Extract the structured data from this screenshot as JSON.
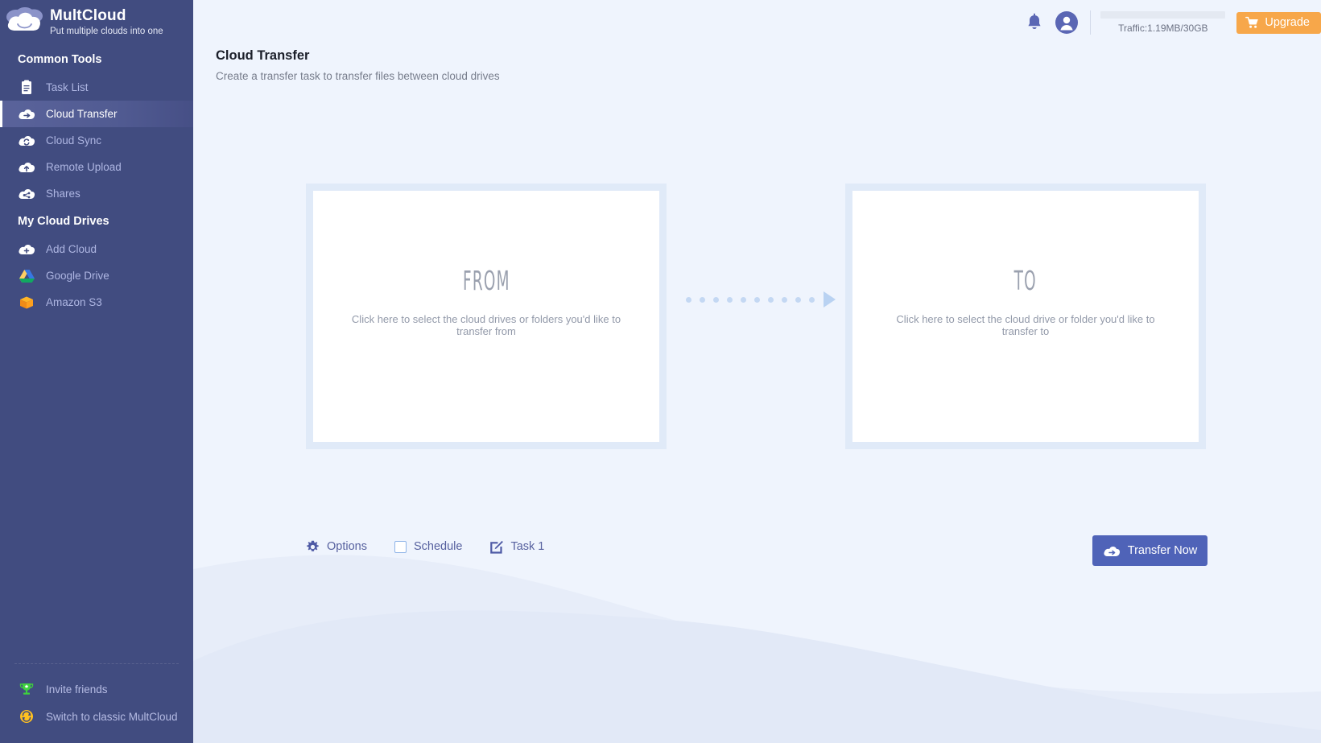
{
  "brand": {
    "name": "MultCloud",
    "tagline": "Put multiple clouds into one",
    "logo_icon": "cloud-logo-icon"
  },
  "sidebar": {
    "sections": [
      {
        "title": "Common Tools",
        "items": [
          {
            "label": "Task List",
            "icon": "task-list-icon",
            "active": false
          },
          {
            "label": "Cloud Transfer",
            "icon": "cloud-transfer-icon",
            "active": true
          },
          {
            "label": "Cloud Sync",
            "icon": "cloud-sync-icon",
            "active": false
          },
          {
            "label": "Remote Upload",
            "icon": "cloud-upload-icon",
            "active": false
          },
          {
            "label": "Shares",
            "icon": "cloud-share-icon",
            "active": false
          }
        ]
      },
      {
        "title": "My Cloud Drives",
        "items": [
          {
            "label": "Add Cloud",
            "icon": "add-cloud-icon",
            "active": false
          },
          {
            "label": "Google Drive",
            "icon": "google-drive-icon",
            "active": false
          },
          {
            "label": "Amazon S3",
            "icon": "amazon-s3-icon",
            "active": false
          }
        ]
      }
    ],
    "bottom_items": [
      {
        "label": "Invite friends",
        "icon": "trophy-icon"
      },
      {
        "label": "Switch to classic MultCloud",
        "icon": "switch-icon"
      }
    ]
  },
  "topbar": {
    "notification_icon": "bell-icon",
    "account_icon": "user-avatar-icon",
    "traffic_text": "Traffic:1.19MB/30GB",
    "traffic_used_percent": 0,
    "upgrade_label": "Upgrade",
    "upgrade_icon": "cart-icon"
  },
  "page": {
    "title": "Cloud Transfer",
    "subtitle": "Create a transfer task to transfer files between cloud drives"
  },
  "transfer": {
    "from_panel": {
      "label": "FROM",
      "description": "Click here to select the cloud drives or folders you'd like to transfer from"
    },
    "to_panel": {
      "label": "TO",
      "description": "Click here to select the cloud drive or folder you'd like to transfer to"
    },
    "arrow_icon": "dotted-arrow-right-icon",
    "arrow_dot_count": 10
  },
  "toolbar": {
    "options_label": "Options",
    "options_icon": "gear-icon",
    "schedule_label": "Schedule",
    "schedule_icon": "checkbox-icon",
    "schedule_checked": false,
    "task_name": "Task 1",
    "task_icon": "edit-pencil-icon",
    "transfer_now_label": "Transfer Now",
    "transfer_now_icon": "cloud-transfer-icon"
  },
  "colors": {
    "sidebar_bg": "#414c80",
    "main_bg": "#eff4fd",
    "accent_blue": "#4f63b8",
    "upgrade_orange": "#f7a74a",
    "panel_border": "#e0eaf8"
  }
}
